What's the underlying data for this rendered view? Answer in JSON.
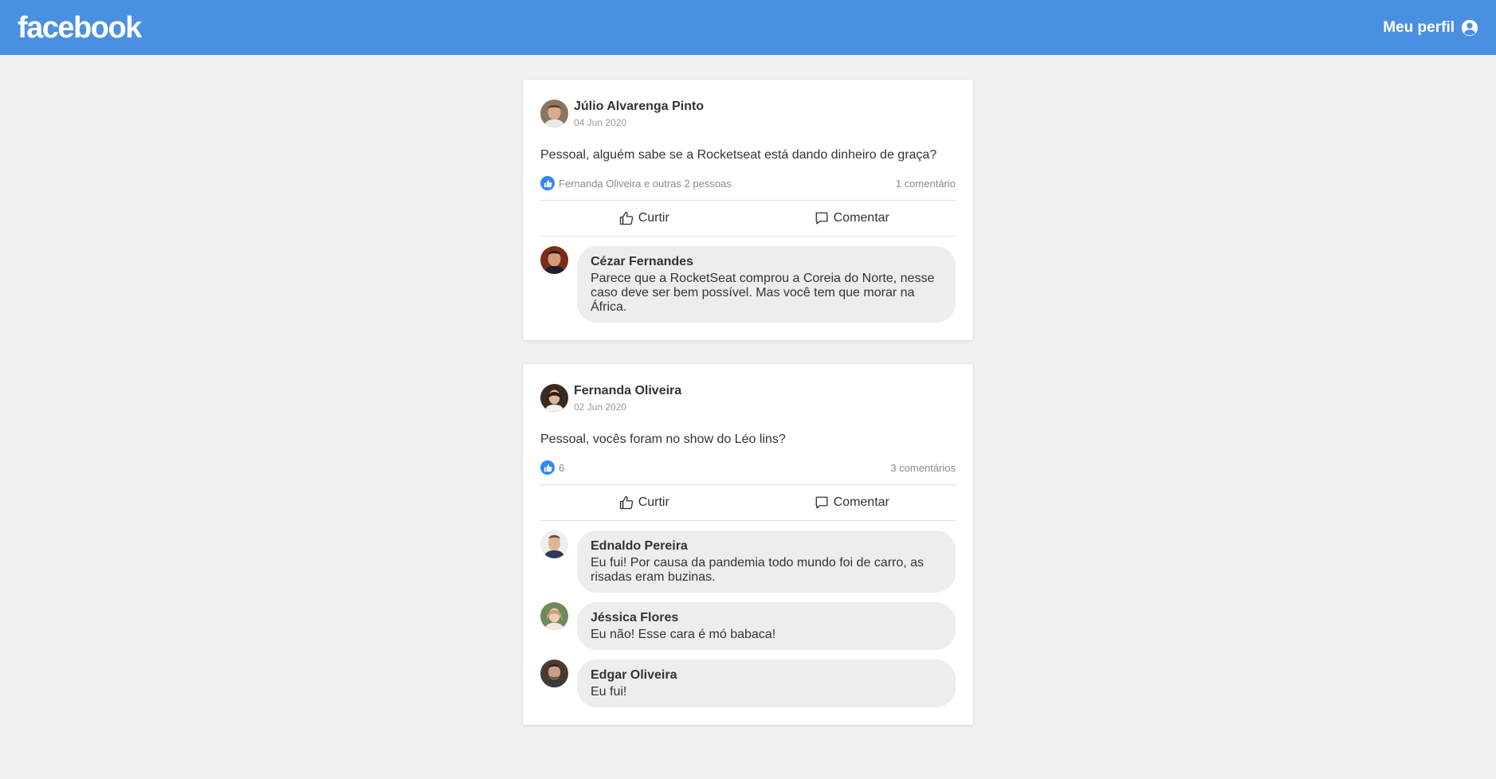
{
  "header": {
    "logo": "facebook",
    "profile_label": "Meu perfil",
    "background": "#4a90e2"
  },
  "posts": [
    {
      "author": "Júlio Alvarenga Pinto",
      "date": "04 Jun 2020",
      "content": "Pessoal, alguém sabe se a Rocketseat está dando dinheiro de graça?",
      "likes_text": "Fernanda Oliveira e outras 2 pessoas",
      "comments_count": "1 comentário",
      "like_label": "Curtir",
      "comment_label": "Comentar",
      "comments": [
        {
          "author": "Cézar Fernandes",
          "text": "Parece que a RocketSeat comprou a Coreia do Norte, nesse caso deve ser bem possível. Mas você tem que morar na África."
        }
      ]
    },
    {
      "author": "Fernanda Oliveira",
      "date": "02 Jun 2020",
      "content": "Pessoal, vocês foram no show do Léo lins?",
      "likes_text": "6",
      "comments_count": "3 comentários",
      "like_label": "Curtir",
      "comment_label": "Comentar",
      "comments": [
        {
          "author": "Ednaldo Pereira",
          "text": "Eu fui! Por causa da pandemia todo mundo foi de carro, as risadas eram buzinas."
        },
        {
          "author": "Jéssica Flores",
          "text": "Eu não! Esse cara é mó babaca!"
        },
        {
          "author": "Edgar Oliveira",
          "text": "Eu fui!"
        }
      ]
    }
  ],
  "colors": {
    "like_blue": "#2d88ff",
    "page_bg": "#f1f1f1",
    "bubble_bg": "#ededed"
  }
}
